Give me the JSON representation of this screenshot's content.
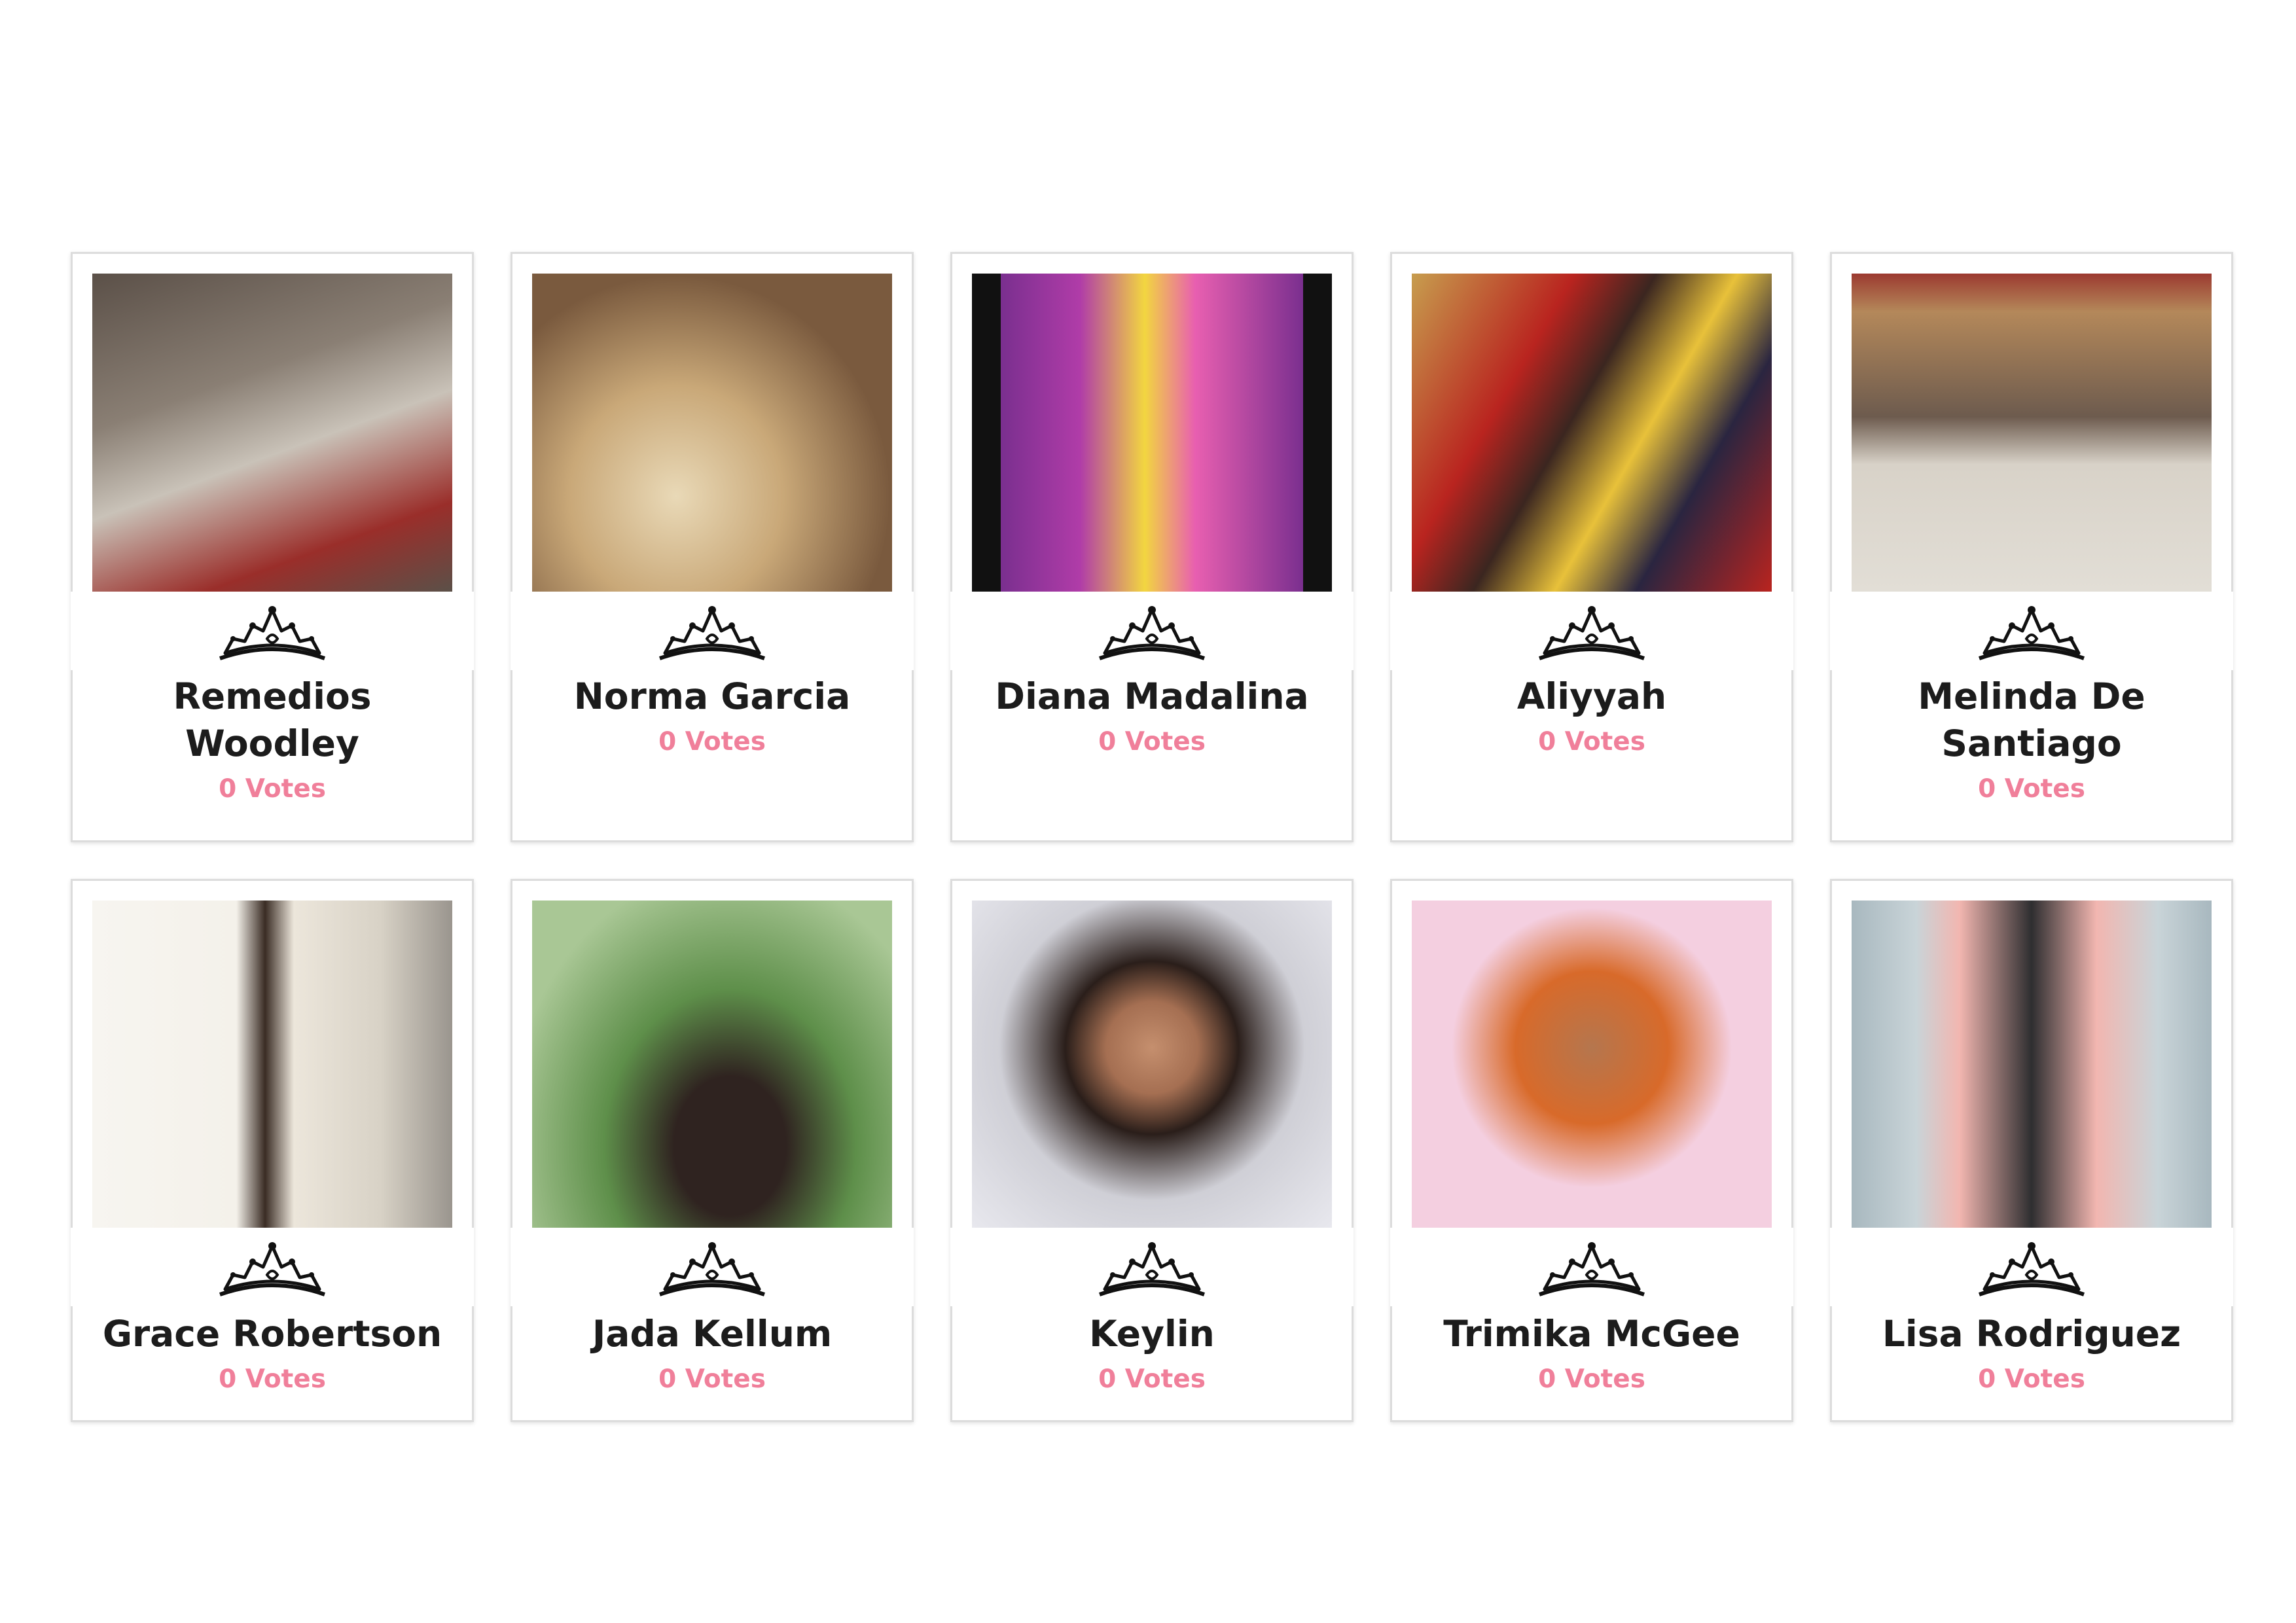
{
  "contestants": [
    {
      "name": "Remedios Woodley",
      "votes": "0 Votes",
      "photo_colors": [
        "#8a7f74",
        "#c9c2b8",
        "#5b5048"
      ]
    },
    {
      "name": "Norma Garcia",
      "votes": "0 Votes",
      "photo_colors": [
        "#b48a5e",
        "#e9d9b7",
        "#7a5a3e"
      ]
    },
    {
      "name": "Diana Madalina",
      "votes": "0 Votes",
      "photo_colors": [
        "#b03ca8",
        "#f2d640",
        "#7a2f8f"
      ]
    },
    {
      "name": "Aliyyah",
      "votes": "0 Votes",
      "photo_colors": [
        "#b9241f",
        "#e8c13a",
        "#3b2620"
      ]
    },
    {
      "name": "Melinda De Santiago",
      "votes": "0 Votes",
      "photo_colors": [
        "#9c3a30",
        "#e2ded6",
        "#6d5b4e"
      ]
    },
    {
      "name": "Grace Robertson",
      "votes": "0 Votes",
      "photo_colors": [
        "#f4f1ea",
        "#d8d2c6",
        "#3a2c24"
      ]
    },
    {
      "name": "Jada Kellum",
      "votes": "0 Votes",
      "photo_colors": [
        "#5e8f4a",
        "#a9c795",
        "#2f2320"
      ]
    },
    {
      "name": "Keylin",
      "votes": "0 Votes",
      "photo_colors": [
        "#cfcfd6",
        "#e8e8ee",
        "#2a1e1a"
      ]
    },
    {
      "name": "Trimika McGee",
      "votes": "0 Votes",
      "photo_colors": [
        "#f4cfe0",
        "#d86a2a",
        "#c49a2e"
      ]
    },
    {
      "name": "Lisa Rodriguez",
      "votes": "0 Votes",
      "photo_colors": [
        "#f2b6b0",
        "#a8b8bf",
        "#2e2e30"
      ]
    }
  ],
  "accent_color": "#f07f9a",
  "icons": {
    "crown": "tiara-icon"
  }
}
